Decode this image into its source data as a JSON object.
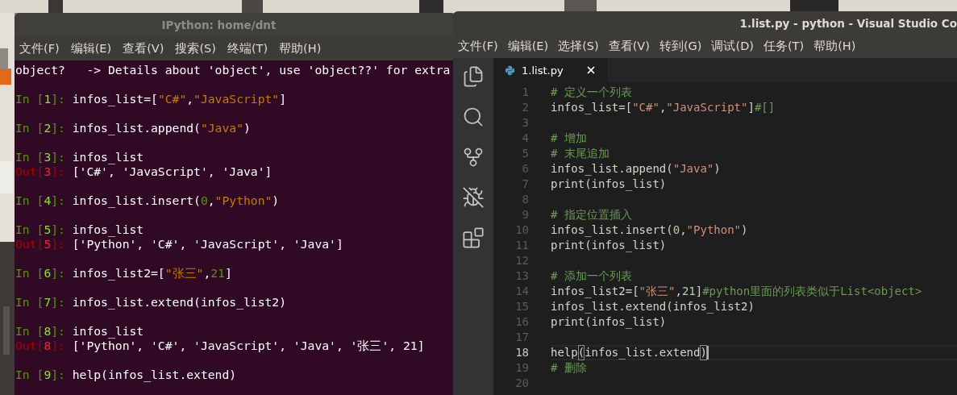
{
  "terminal": {
    "title": "IPython: home/dnt",
    "menu": [
      "文件(F)",
      "编辑(E)",
      "查看(V)",
      "搜索(S)",
      "终端(T)",
      "帮助(H)"
    ],
    "lines": [
      {
        "kind": "info",
        "tokens": [
          {
            "t": "object?   -> Details about 'object', use 'object??' for extra",
            "kind": "plain"
          }
        ]
      },
      {
        "kind": "in",
        "tokens": [
          {
            "t": "In [",
            "kind": "in"
          },
          {
            "t": "1",
            "kind": "in_num"
          },
          {
            "t": "]: ",
            "kind": "in"
          },
          {
            "t": "infos_list=[",
            "kind": "plain"
          },
          {
            "t": "\"C#\"",
            "kind": "str"
          },
          {
            "t": ",",
            "kind": "plain"
          },
          {
            "t": "\"JavaScript\"",
            "kind": "str"
          },
          {
            "t": "]",
            "kind": "plain"
          }
        ]
      },
      {
        "kind": "in",
        "tokens": [
          {
            "t": "In [",
            "kind": "in"
          },
          {
            "t": "2",
            "kind": "in_num"
          },
          {
            "t": "]: ",
            "kind": "in"
          },
          {
            "t": "infos_list.append(",
            "kind": "plain"
          },
          {
            "t": "\"Java\"",
            "kind": "str"
          },
          {
            "t": ")",
            "kind": "plain"
          }
        ]
      },
      {
        "kind": "in",
        "tokens": [
          {
            "t": "In [",
            "kind": "in"
          },
          {
            "t": "3",
            "kind": "in_num"
          },
          {
            "t": "]: ",
            "kind": "in"
          },
          {
            "t": "infos_list",
            "kind": "plain"
          }
        ]
      },
      {
        "kind": "out",
        "tokens": [
          {
            "t": "Out[",
            "kind": "out"
          },
          {
            "t": "3",
            "kind": "out_num"
          },
          {
            "t": "]: ",
            "kind": "out"
          },
          {
            "t": "['C#', 'JavaScript', 'Java']",
            "kind": "plain"
          }
        ]
      },
      {
        "kind": "in",
        "tokens": [
          {
            "t": "In [",
            "kind": "in"
          },
          {
            "t": "4",
            "kind": "in_num"
          },
          {
            "t": "]: ",
            "kind": "in"
          },
          {
            "t": "infos_list.insert(",
            "kind": "plain"
          },
          {
            "t": "0",
            "kind": "num"
          },
          {
            "t": ",",
            "kind": "plain"
          },
          {
            "t": "\"Python\"",
            "kind": "str"
          },
          {
            "t": ")",
            "kind": "plain"
          }
        ]
      },
      {
        "kind": "in",
        "tokens": [
          {
            "t": "In [",
            "kind": "in"
          },
          {
            "t": "5",
            "kind": "in_num"
          },
          {
            "t": "]: ",
            "kind": "in"
          },
          {
            "t": "infos_list",
            "kind": "plain"
          }
        ]
      },
      {
        "kind": "out",
        "tokens": [
          {
            "t": "Out[",
            "kind": "out"
          },
          {
            "t": "5",
            "kind": "out_num"
          },
          {
            "t": "]: ",
            "kind": "out"
          },
          {
            "t": "['Python', 'C#', 'JavaScript', 'Java']",
            "kind": "plain"
          }
        ]
      },
      {
        "kind": "in",
        "tokens": [
          {
            "t": "In [",
            "kind": "in"
          },
          {
            "t": "6",
            "kind": "in_num"
          },
          {
            "t": "]: ",
            "kind": "in"
          },
          {
            "t": "infos_list2=[",
            "kind": "plain"
          },
          {
            "t": "\"张三\"",
            "kind": "str"
          },
          {
            "t": ",",
            "kind": "plain"
          },
          {
            "t": "21",
            "kind": "num"
          },
          {
            "t": "]",
            "kind": "plain"
          }
        ]
      },
      {
        "kind": "in",
        "tokens": [
          {
            "t": "In [",
            "kind": "in"
          },
          {
            "t": "7",
            "kind": "in_num"
          },
          {
            "t": "]: ",
            "kind": "in"
          },
          {
            "t": "infos_list.extend(infos_list2)",
            "kind": "plain"
          }
        ]
      },
      {
        "kind": "in",
        "tokens": [
          {
            "t": "In [",
            "kind": "in"
          },
          {
            "t": "8",
            "kind": "in_num"
          },
          {
            "t": "]: ",
            "kind": "in"
          },
          {
            "t": "infos_list",
            "kind": "plain"
          }
        ]
      },
      {
        "kind": "out",
        "tokens": [
          {
            "t": "Out[",
            "kind": "out"
          },
          {
            "t": "8",
            "kind": "out_num"
          },
          {
            "t": "]: ",
            "kind": "out"
          },
          {
            "t": "['Python', 'C#', 'JavaScript', 'Java', '张三', 21]",
            "kind": "plain"
          }
        ]
      },
      {
        "kind": "in",
        "tokens": [
          {
            "t": "In [",
            "kind": "in"
          },
          {
            "t": "9",
            "kind": "in_num"
          },
          {
            "t": "]: ",
            "kind": "in"
          },
          {
            "t": "help(infos_list.extend)",
            "kind": "plain"
          }
        ]
      }
    ]
  },
  "editor": {
    "title": "1.list.py - python - Visual Studio Co",
    "menu": [
      "文件(F)",
      "编辑(E)",
      "选择(S)",
      "查看(V)",
      "转到(G)",
      "调试(D)",
      "任务(T)",
      "帮助(H)"
    ],
    "tabs": [
      {
        "label": "1.list.py",
        "selected": true
      }
    ],
    "lines": [
      {
        "number": "1",
        "current": false,
        "tokens": [
          {
            "t": "# 定义一个列表",
            "kind": "comment"
          }
        ]
      },
      {
        "number": "2",
        "current": false,
        "tokens": [
          {
            "t": "infos_list=[",
            "kind": "plain"
          },
          {
            "t": "\"C#\"",
            "kind": "str"
          },
          {
            "t": ",",
            "kind": "plain"
          },
          {
            "t": "\"JavaScript\"",
            "kind": "str"
          },
          {
            "t": "]",
            "kind": "plain"
          },
          {
            "t": "#[]",
            "kind": "comment"
          }
        ]
      },
      {
        "number": "3",
        "current": false
      },
      {
        "number": "4",
        "current": false,
        "tokens": [
          {
            "t": "# 增加",
            "kind": "comment"
          }
        ]
      },
      {
        "number": "5",
        "current": false,
        "tokens": [
          {
            "t": "# 末尾追加",
            "kind": "comment"
          }
        ]
      },
      {
        "number": "6",
        "current": false,
        "tokens": [
          {
            "t": "infos_list.append(",
            "kind": "plain"
          },
          {
            "t": "\"Java\"",
            "kind": "str"
          },
          {
            "t": ")",
            "kind": "plain"
          }
        ]
      },
      {
        "number": "7",
        "current": false,
        "tokens": [
          {
            "t": "print(infos_list)",
            "kind": "plain"
          }
        ]
      },
      {
        "number": "8",
        "current": false
      },
      {
        "number": "9",
        "current": false,
        "tokens": [
          {
            "t": "# 指定位置插入",
            "kind": "comment"
          }
        ]
      },
      {
        "number": "10",
        "current": false,
        "tokens": [
          {
            "t": "infos_list.insert(",
            "kind": "plain"
          },
          {
            "t": "0",
            "kind": "num"
          },
          {
            "t": ",",
            "kind": "plain"
          },
          {
            "t": "\"Python\"",
            "kind": "str"
          },
          {
            "t": ")",
            "kind": "plain"
          }
        ]
      },
      {
        "number": "11",
        "current": false,
        "tokens": [
          {
            "t": "print(infos_list)",
            "kind": "plain"
          }
        ]
      },
      {
        "number": "12",
        "current": false
      },
      {
        "number": "13",
        "current": false,
        "tokens": [
          {
            "t": "# 添加一个列表",
            "kind": "comment"
          }
        ]
      },
      {
        "number": "14",
        "current": false,
        "tokens": [
          {
            "t": "infos_list2=[",
            "kind": "plain"
          },
          {
            "t": "\"张三\"",
            "kind": "str"
          },
          {
            "t": ",",
            "kind": "plain"
          },
          {
            "t": "21",
            "kind": "num"
          },
          {
            "t": "]",
            "kind": "plain"
          },
          {
            "t": "#python里面的列表类似于List<object>",
            "kind": "comment"
          }
        ]
      },
      {
        "number": "15",
        "current": false,
        "tokens": [
          {
            "t": "infos_list.extend(infos_list2)",
            "kind": "plain"
          }
        ]
      },
      {
        "number": "16",
        "current": false,
        "tokens": [
          {
            "t": "print(infos_list)",
            "kind": "plain"
          }
        ]
      },
      {
        "number": "17",
        "current": false
      },
      {
        "number": "18",
        "current": true,
        "tokens": [
          {
            "t": "help",
            "kind": "plain"
          },
          {
            "t": "(",
            "kind": "bracket"
          },
          {
            "t": "infos_list.extend",
            "kind": "plain"
          },
          {
            "t": ")",
            "kind": "bracket"
          }
        ]
      },
      {
        "number": "19",
        "current": false,
        "tokens": [
          {
            "t": "# 删除",
            "kind": "comment"
          }
        ]
      },
      {
        "number": "20",
        "current": false
      }
    ]
  }
}
